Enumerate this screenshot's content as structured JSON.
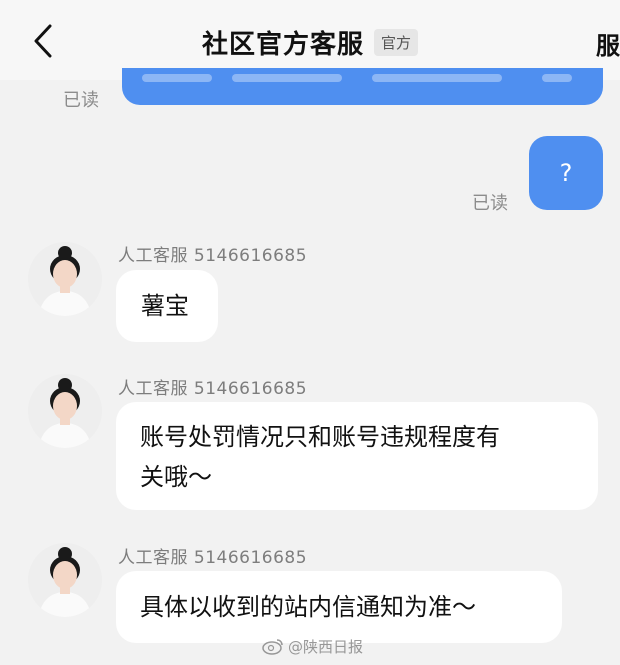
{
  "header": {
    "title": "社区官方客服",
    "badge": "官方",
    "right_text": "服"
  },
  "messages_sent": [
    {
      "read_status": "已读"
    },
    {
      "text": "?",
      "read_status": "已读"
    }
  ],
  "messages_received": [
    {
      "sender": "人工客服 5146616685",
      "text": "薯宝"
    },
    {
      "sender": "人工客服 5146616685",
      "lines": [
        "账号处罚情况只和账号违规程度有",
        "关哦～"
      ]
    },
    {
      "sender": "人工客服 5146616685",
      "text": "具体以收到的站内信通知为准～"
    }
  ],
  "watermark": {
    "text": "@陕西日报"
  },
  "colors": {
    "sent_bubble": "#4f8ff0",
    "received_bubble": "#ffffff",
    "background": "#f2f2f2"
  }
}
